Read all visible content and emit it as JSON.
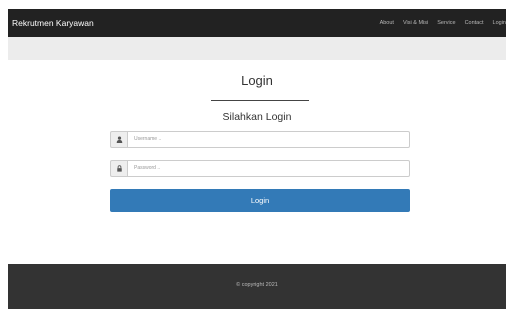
{
  "navbar": {
    "brand": "Rekrutmen Karyawan",
    "items": [
      {
        "label": "About"
      },
      {
        "label": "Visi & Misi"
      },
      {
        "label": "Service"
      },
      {
        "label": "Contact"
      },
      {
        "label": "Login"
      }
    ]
  },
  "login": {
    "title": "Login",
    "subtitle": "Silahkan Login",
    "username": {
      "placeholder": "Username ..",
      "icon": "user-icon"
    },
    "password": {
      "placeholder": "Password ..",
      "icon": "lock-icon"
    },
    "button_label": "Login"
  },
  "footer": {
    "copyright": "© copyright 2021"
  },
  "colors": {
    "navbar": "#222222",
    "primary": "#337ab7",
    "footer": "#333333"
  }
}
